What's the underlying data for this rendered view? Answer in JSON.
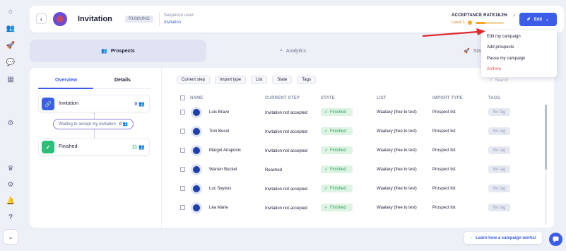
{
  "sidebar": {
    "items": [
      {
        "icon": "home-icon",
        "glyph": "⌂"
      },
      {
        "icon": "users-icon",
        "glyph": "👥"
      },
      {
        "icon": "rocket-icon",
        "glyph": "🚀"
      },
      {
        "icon": "chat-icon",
        "glyph": "💬"
      },
      {
        "icon": "grid-icon",
        "glyph": "▦"
      },
      {
        "icon": "settings-icon",
        "glyph": "⚙"
      }
    ],
    "bottom_items": [
      {
        "icon": "crown-icon",
        "glyph": "♛"
      },
      {
        "icon": "gear-icon",
        "glyph": "⚙"
      },
      {
        "icon": "bell-icon",
        "glyph": "🔔"
      },
      {
        "icon": "help-icon",
        "glyph": "?"
      }
    ],
    "expand_glyph": "⌄"
  },
  "header": {
    "back_glyph": "‹",
    "title": "Invitation",
    "status": "RUNNING",
    "sequence_label": "Sequence used",
    "sequence_value": "Invitation",
    "acceptance_label": "ACCEPTANCE RATE",
    "acceptance_value": "18.2%",
    "check_glyph": "✓",
    "level_label": "Level 1",
    "level_progress": 0.35,
    "edit_label": "Edit",
    "edit_glyph": "✐",
    "edit_chevron": "⌄"
  },
  "dropdown": {
    "items": [
      "Edit my campaign",
      "Add prospects",
      "Pause my campaign",
      "Archive"
    ]
  },
  "tabs": {
    "prospects": "Prospects",
    "analytics": "Analytics",
    "third_partial": "Sta"
  },
  "left_panel": {
    "tab_overview": "Overview",
    "tab_details": "Details",
    "steps": [
      {
        "name": "Invitation",
        "count": "0",
        "icon": "link-icon",
        "glyph": "🔗",
        "color": "#3b5de7"
      },
      {
        "name": "Finished",
        "count": "11",
        "icon": "check-icon",
        "glyph": "✓",
        "color": "#2bbf7a"
      }
    ],
    "waiting_label": "Waiting to accept my invitation",
    "waiting_count": "0",
    "people_glyph": "👥"
  },
  "filters": [
    "Current step",
    "Import type",
    "List",
    "State",
    "Tags"
  ],
  "search": {
    "placeholder": "Search",
    "glyph": "⌕"
  },
  "table": {
    "headers": [
      "NAME",
      "CURRENT STEP",
      "STATE",
      "LIST",
      "IMPORT TYPE",
      "TAGS"
    ],
    "rows": [
      {
        "name": "Luis Bravo",
        "step": "Invitation not accepted",
        "state": "Finished",
        "list": "Waalaxy (free to test)",
        "import": "Prospect list",
        "tag": "No tag"
      },
      {
        "name": "Tom Bocel",
        "step": "Invitation not accepted",
        "state": "Finished",
        "list": "Waalaxy (free to test)",
        "import": "Prospect list",
        "tag": "No tag"
      },
      {
        "name": "Margot Airaponic",
        "step": "Invitation not accepted",
        "state": "Finished",
        "list": "Waalaxy (free to test)",
        "import": "Prospect list",
        "tag": "No tag"
      },
      {
        "name": "Warren Bucket",
        "step": "Reached",
        "state": "Finished",
        "list": "Waalaxy (free to test)",
        "import": "Prospect list",
        "tag": "No tag"
      },
      {
        "name": "Luc Seyeux",
        "step": "Invitation not accepted",
        "state": "Finished",
        "list": "Waalaxy (free to test)",
        "import": "Prospect list",
        "tag": "No tag"
      },
      {
        "name": "Léa Marie",
        "step": "Invitation not accepted",
        "state": "Finished",
        "list": "Waalaxy (free to test)",
        "import": "Prospect list",
        "tag": "No tag"
      }
    ]
  },
  "help": {
    "label": "Learn how a campaign works!",
    "glyph": "↑"
  },
  "colors": {
    "accent": "#3b5de7",
    "success": "#2bbf7a",
    "warning": "#f5a623",
    "danger": "#e0514e",
    "arrow": "#e0282e"
  }
}
